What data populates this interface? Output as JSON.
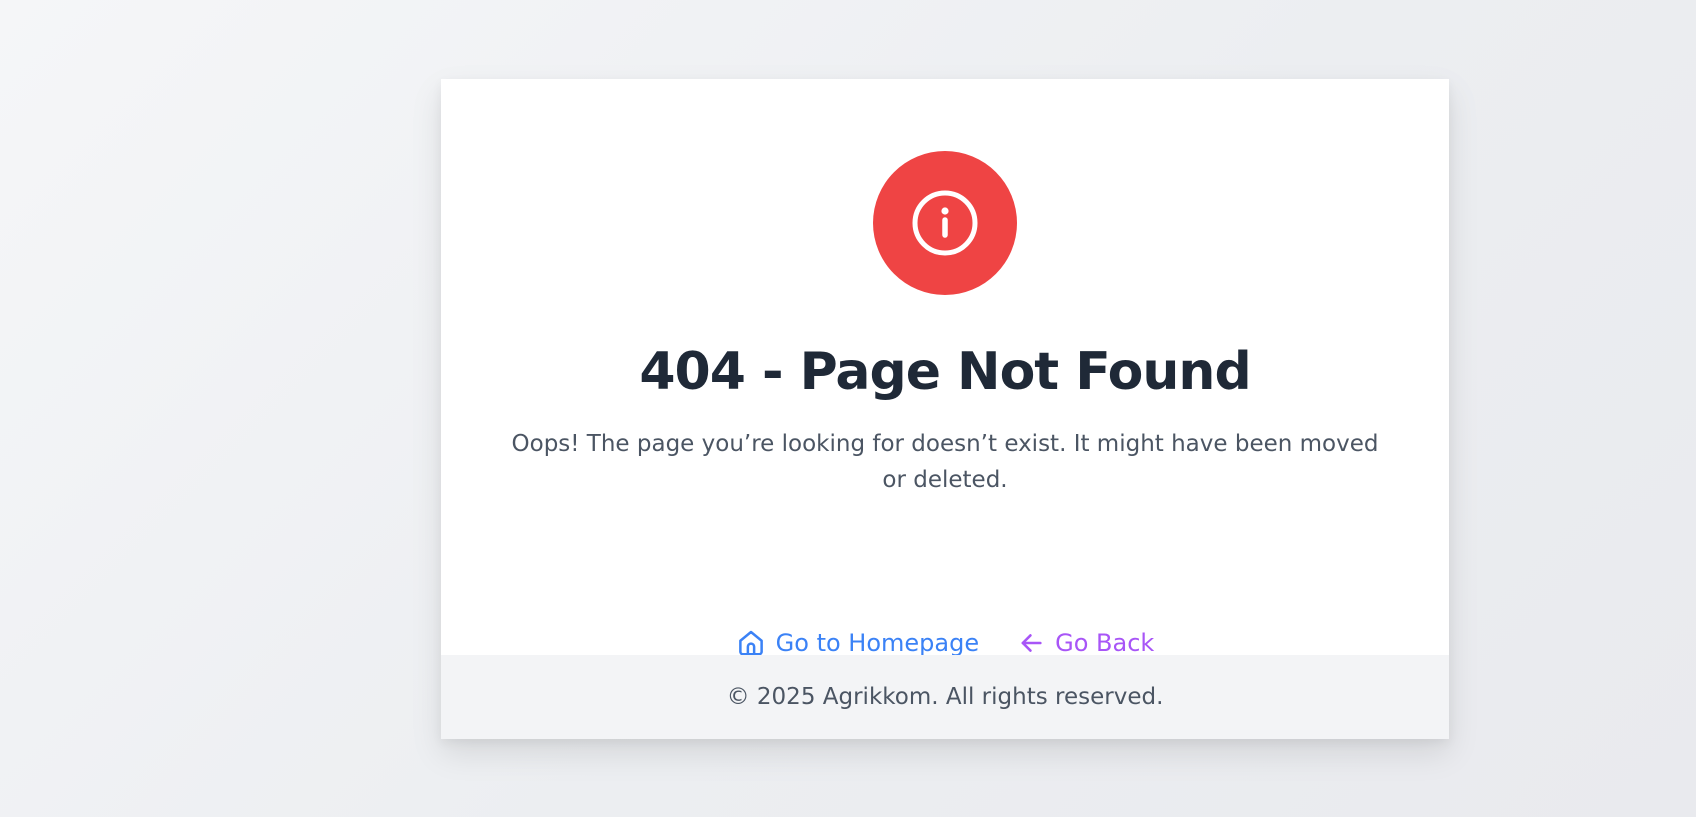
{
  "page": {
    "background": "#eef0f3"
  },
  "error": {
    "icon": "info-circle-icon",
    "icon_bg_color": "#ef4444",
    "title": "404 - Page Not Found",
    "message": "Oops! The page you’re looking for doesn’t exist. It might have been moved or deleted."
  },
  "actions": {
    "home": {
      "label": "Go to Homepage",
      "icon": "home-icon",
      "color": "#3b82f6"
    },
    "back": {
      "label": "Go Back",
      "icon": "arrow-left-icon",
      "color": "#a855f7"
    }
  },
  "footer": {
    "text": "© 2025 Agrikkom. All rights reserved."
  }
}
